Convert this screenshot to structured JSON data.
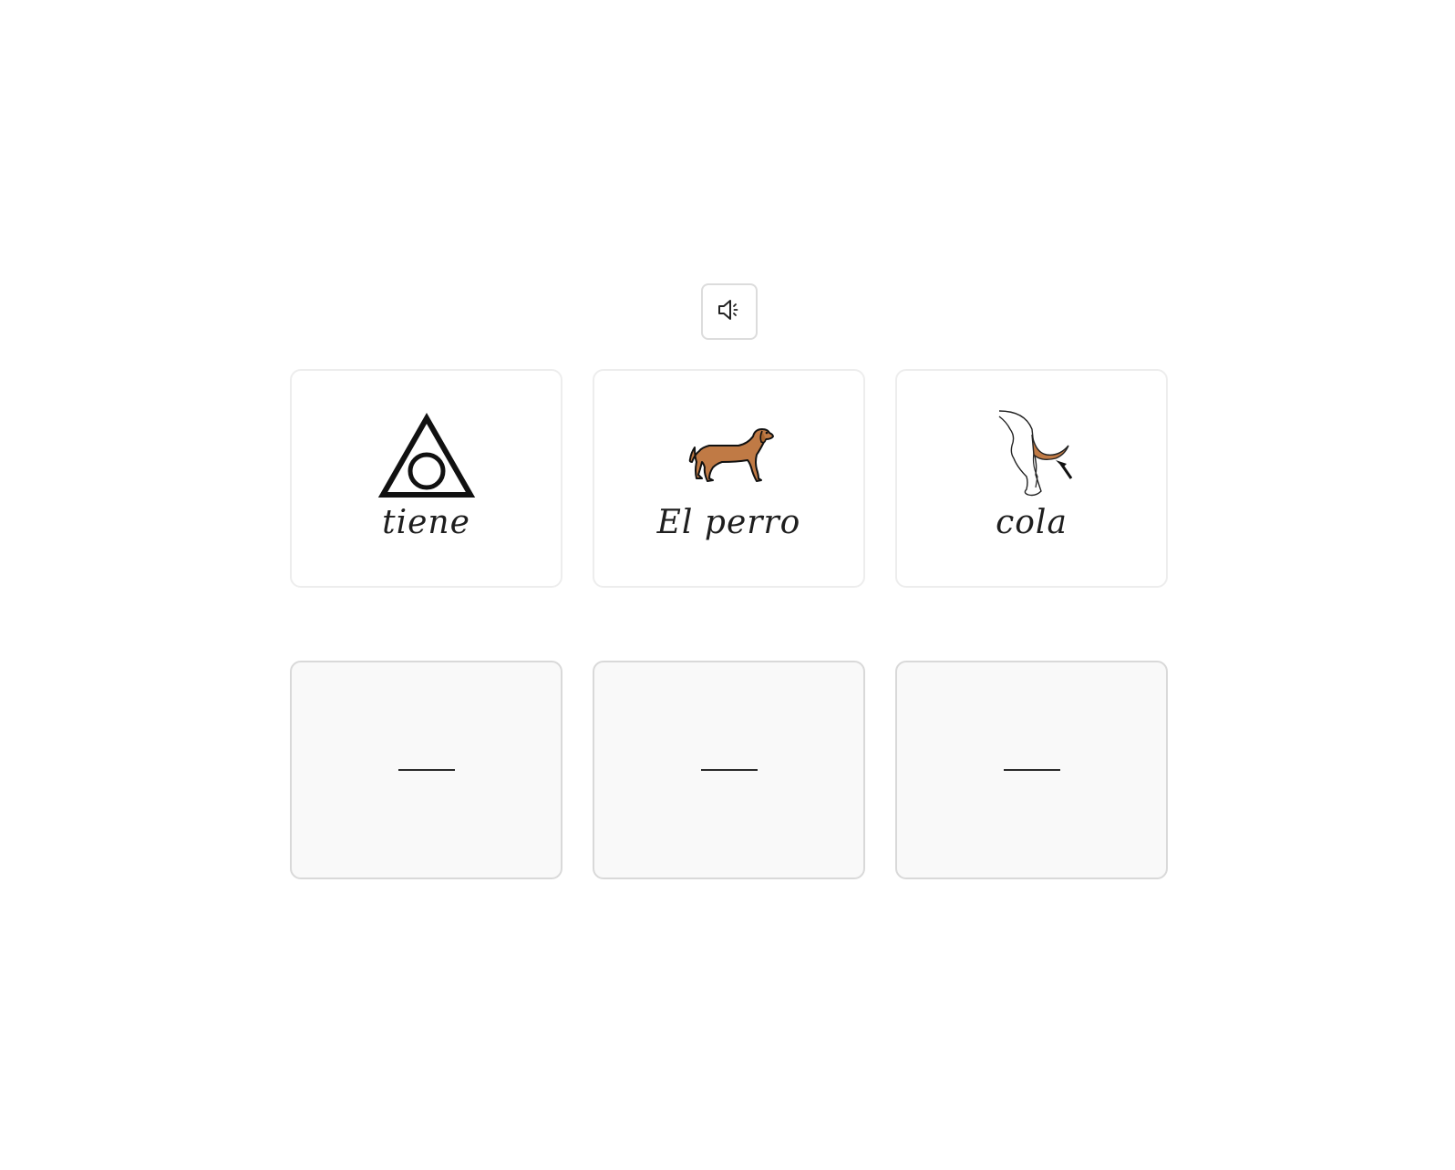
{
  "sound_button": {
    "icon": "speaker-icon"
  },
  "word_cards": [
    {
      "word": "tiene",
      "icon": "triangle-circle-icon"
    },
    {
      "word": "El perro",
      "icon": "dog-icon"
    },
    {
      "word": "cola",
      "icon": "dog-tail-icon"
    }
  ],
  "answer_slots": [
    {
      "value": ""
    },
    {
      "value": ""
    },
    {
      "value": ""
    }
  ],
  "colors": {
    "dog_fill": "#c07a45",
    "card_border": "#ededed",
    "slot_background": "#f9f9f9"
  }
}
